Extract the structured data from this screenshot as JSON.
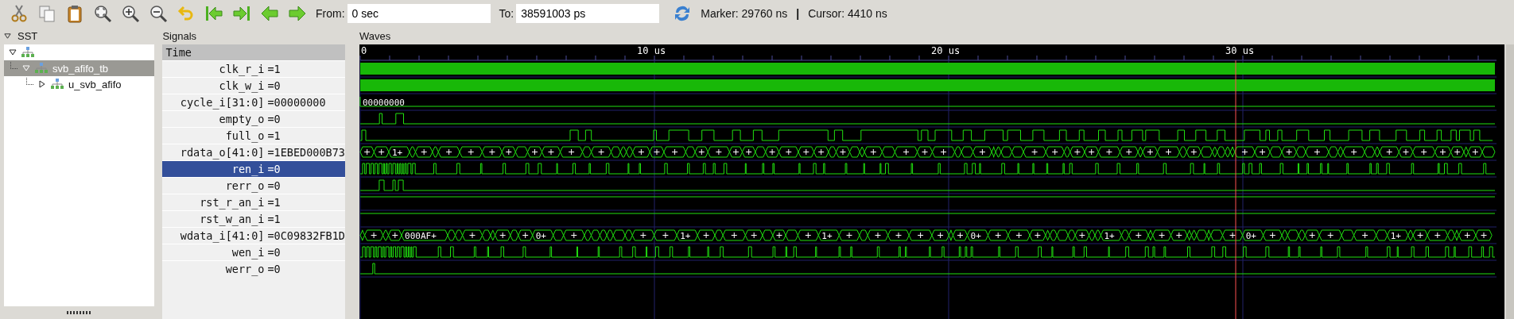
{
  "toolbar": {
    "from_label": "From:",
    "from_value": "0 sec",
    "to_label": "To:",
    "to_value": "38591003 ps",
    "marker": "Marker: 29760 ns",
    "separator": "|",
    "cursor": "Cursor: 4410 ns"
  },
  "sst": {
    "title": "SST",
    "tree": [
      {
        "expanded": true,
        "selected": false,
        "children": [
          {
            "label": "svb_afifo_tb",
            "expanded": true,
            "selected": true,
            "children": [
              {
                "label": "u_svb_afifo",
                "expanded": false,
                "selected": false
              }
            ]
          }
        ]
      }
    ]
  },
  "signals": {
    "title": "Signals",
    "header": "Time",
    "rows": [
      {
        "name": "clk_r_i",
        "value": "=1",
        "selected": false,
        "kind": "clock"
      },
      {
        "name": "clk_w_i",
        "value": "=0",
        "selected": false,
        "kind": "clock"
      },
      {
        "name": "cycle_i[31:0]",
        "value": "=00000000",
        "selected": false,
        "kind": "constbus",
        "labels": [
          "00000000"
        ]
      },
      {
        "name": "empty_o",
        "value": "=0",
        "selected": false,
        "kind": "glitch"
      },
      {
        "name": "full_o",
        "value": "=1",
        "selected": false,
        "kind": "toggle"
      },
      {
        "name": "rdata_o[41:0]",
        "value": "=1EBED000B73",
        "selected": false,
        "kind": "bus",
        "labels": [
          "1+"
        ]
      },
      {
        "name": "ren_i",
        "value": "=0",
        "selected": true,
        "kind": "strobe"
      },
      {
        "name": "rerr_o",
        "value": "=0",
        "selected": false,
        "kind": "glitch"
      },
      {
        "name": "rst_r_an_i",
        "value": "=1",
        "selected": false,
        "kind": "high"
      },
      {
        "name": "rst_w_an_i",
        "value": "=1",
        "selected": false,
        "kind": "high"
      },
      {
        "name": "wdata_i[41:0]",
        "value": "=0C09832FB1D",
        "selected": false,
        "kind": "bus",
        "labels": [
          "000AF+",
          "0+",
          "1+",
          "1+",
          "0+",
          "1+",
          "0+",
          "1+"
        ]
      },
      {
        "name": "wen_i",
        "value": "=0",
        "selected": false,
        "kind": "strobe"
      },
      {
        "name": "werr_o",
        "value": "=0",
        "selected": false,
        "kind": "glitch"
      }
    ]
  },
  "waves": {
    "title": "Waves",
    "ruler": [
      {
        "label": "0"
      },
      {
        "label": "10 us"
      },
      {
        "label": "20 us"
      },
      {
        "label": "30 us"
      }
    ]
  }
}
